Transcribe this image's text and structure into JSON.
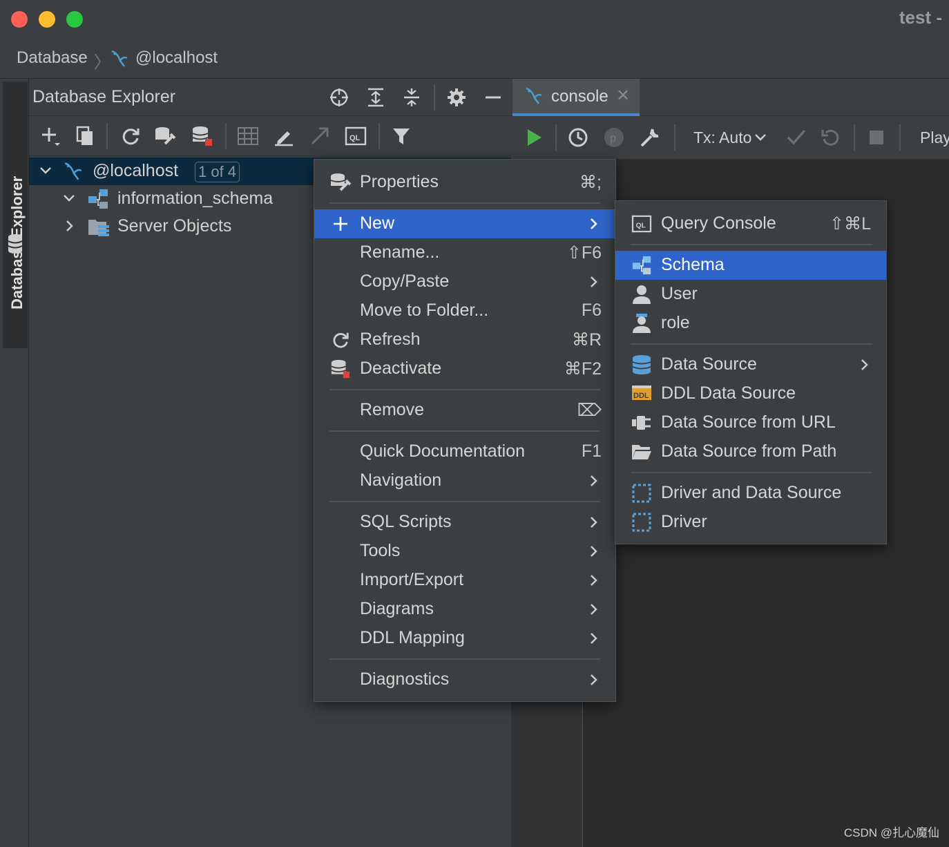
{
  "window": {
    "title": "test -"
  },
  "breadcrumb": {
    "root": "Database",
    "separator": "〉",
    "current": "@localhost",
    "icon": "mysql-dolphin-icon"
  },
  "stripe": {
    "label": "Database Explorer",
    "icon": "database-stack-icon"
  },
  "explorer": {
    "title": "Database Explorer",
    "header_icons": [
      "target-icon",
      "expand-all-icon",
      "collapse-all-icon",
      "gear-icon",
      "minimize-icon"
    ],
    "toolbar_icons": [
      "add-icon",
      "copy-icon",
      "refresh-icon",
      "properties-icon",
      "deactivate-icon",
      "table-icon",
      "edit-icon",
      "jump-icon",
      "query-console-icon",
      "filter-icon"
    ],
    "tree": [
      {
        "label": "@localhost",
        "badge": "1 of 4",
        "expanded": true,
        "icon": "mysql-dolphin-icon"
      },
      {
        "label": "information_schema",
        "expanded": true,
        "icon": "schema-icon"
      },
      {
        "label": "Server Objects",
        "expanded": false,
        "icon": "folder-server-icon"
      }
    ]
  },
  "editor": {
    "tab": {
      "label": "console",
      "icon": "mysql-dolphin-icon",
      "close": "✕"
    },
    "toolbar": {
      "tx_label": "Tx: Auto",
      "playground_label": "Play"
    }
  },
  "context_menu": {
    "items": [
      {
        "label": "Properties",
        "shortcut": "⌘;",
        "icon": "properties-icon"
      },
      {
        "label": "New",
        "submenu": true,
        "icon": "plus-icon",
        "selected": true
      },
      {
        "label": "Rename...",
        "shortcut": "⇧F6"
      },
      {
        "label": "Copy/Paste",
        "submenu": true
      },
      {
        "label": "Move to Folder...",
        "shortcut": "F6"
      },
      {
        "label": "Refresh",
        "shortcut": "⌘R",
        "icon": "refresh-icon"
      },
      {
        "label": "Deactivate",
        "shortcut": "⌘F2",
        "icon": "deactivate-icon"
      },
      {
        "label": "Remove",
        "shortcut": "⌦"
      },
      {
        "label": "Quick Documentation",
        "shortcut": "F1"
      },
      {
        "label": "Navigation",
        "submenu": true
      },
      {
        "label": "SQL Scripts",
        "submenu": true
      },
      {
        "label": "Tools",
        "submenu": true
      },
      {
        "label": "Import/Export",
        "submenu": true
      },
      {
        "label": "Diagrams",
        "submenu": true
      },
      {
        "label": "DDL Mapping",
        "submenu": true
      },
      {
        "label": "Diagnostics",
        "submenu": true
      }
    ]
  },
  "new_submenu": {
    "items": [
      {
        "label": "Query Console",
        "shortcut": "⇧⌘L",
        "icon": "query-console-icon"
      },
      {
        "label": "Schema",
        "icon": "schema-icon",
        "selected": true
      },
      {
        "label": "User",
        "icon": "user-icon"
      },
      {
        "label": "role",
        "icon": "role-icon"
      },
      {
        "label": "Data Source",
        "submenu": true,
        "icon": "data-source-icon"
      },
      {
        "label": "DDL Data Source",
        "icon": "ddl-icon",
        "icon_text": "DDL"
      },
      {
        "label": "Data Source from URL",
        "icon": "url-plug-icon"
      },
      {
        "label": "Data Source from Path",
        "icon": "folder-open-icon"
      },
      {
        "label": "Driver and Data Source",
        "icon": "driver-data-source-icon"
      },
      {
        "label": "Driver",
        "icon": "driver-icon"
      }
    ]
  },
  "watermark": "CSDN @扎心魔仙",
  "colors": {
    "accent": "#2f65ca",
    "mysql_blue": "#4a9fd8",
    "run_green": "#4caf50",
    "deactivate_red": "#d9433b",
    "ddl_orange": "#e0a030"
  }
}
